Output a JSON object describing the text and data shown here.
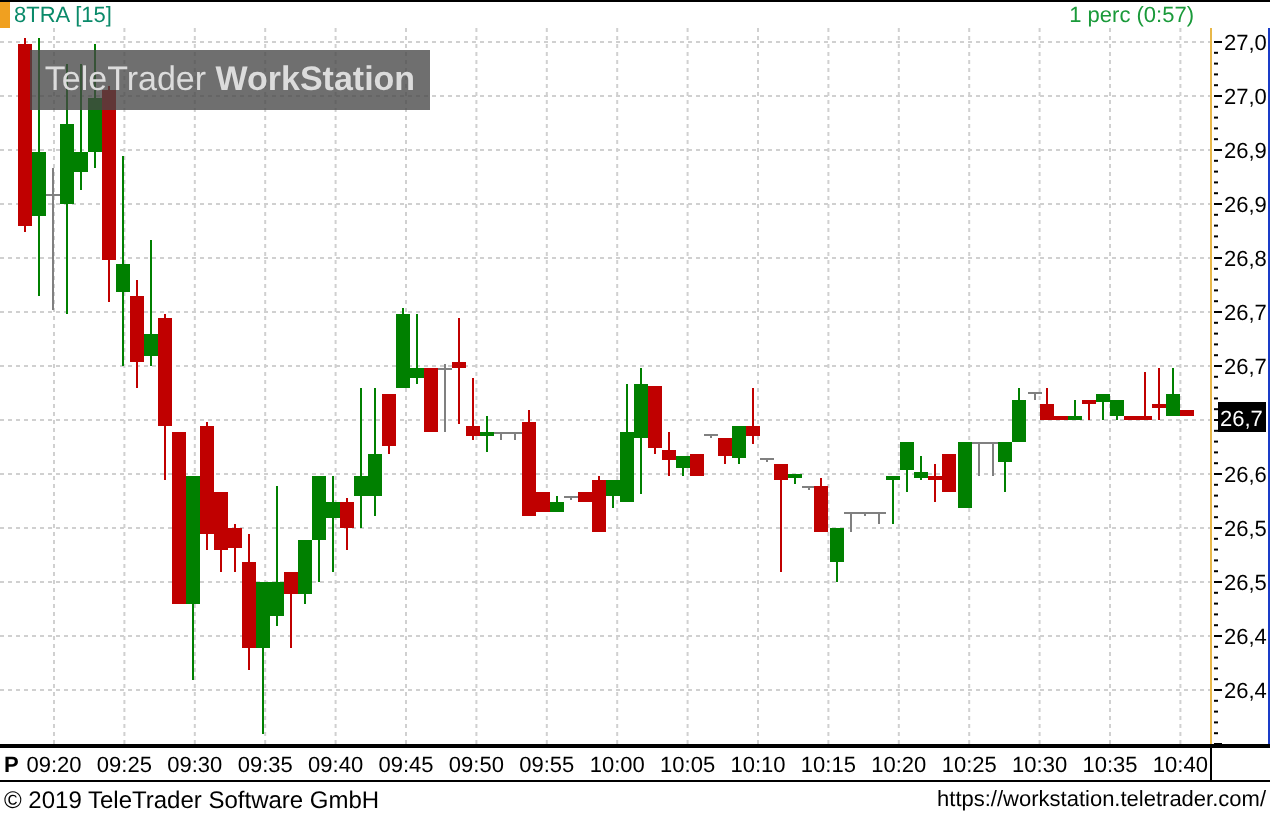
{
  "header": {
    "symbol": "8TRA [15]",
    "interval": "1 perc (0:57)"
  },
  "logo": "TeleTrader **WorkStation**",
  "chart": {
    "y_axis_labels": [
      "27,0",
      "27,0",
      "26,9",
      "26,9",
      "26,8",
      "26,7",
      "26,7",
      "26,6",
      "26,5",
      "26,5",
      "26,4",
      "26,4"
    ],
    "current_price": "26,7",
    "x_axis_prefix": "P",
    "x_axis_labels": [
      "09:20",
      "09:25",
      "09:30",
      "09:35",
      "09:40",
      "09:45",
      "09:50",
      "09:55",
      "10:00",
      "10:05",
      "10:10",
      "10:15",
      "10:20",
      "10:25",
      "10:30",
      "10:35",
      "10:40"
    ]
  },
  "footer": {
    "copyright": "© 2019 TeleTrader Software GmbH",
    "url": "https://workstation.teletrader.com/"
  }
}
